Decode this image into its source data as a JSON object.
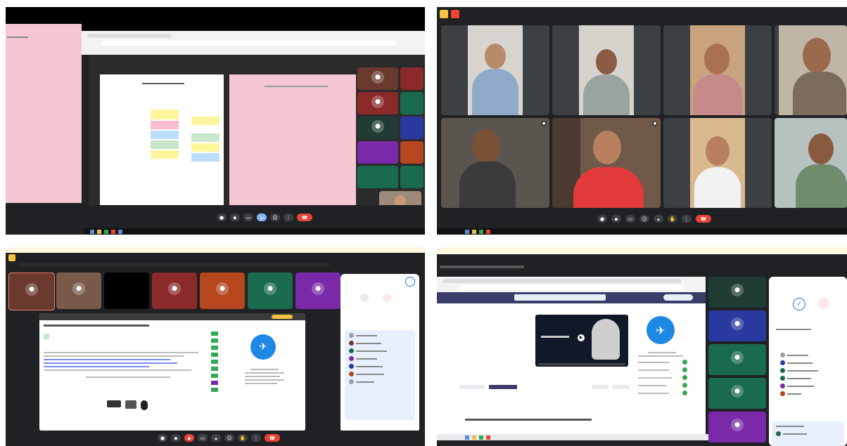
{
  "q1": {
    "tiles": [
      "",
      "",
      "",
      "",
      "",
      "",
      "",
      "",
      "",
      "",
      "",
      ""
    ],
    "clock": "",
    "meeting_title": ""
  },
  "q2": {
    "names": [
      "",
      "",
      "",
      "",
      "",
      "",
      "",
      ""
    ],
    "clock": "",
    "meeting_title": ""
  },
  "q3": {
    "banner_title": "",
    "tiles": [
      {
        "name": "",
        "color": "#6b3a2e"
      },
      {
        "name": "",
        "color": "#7a5a4a"
      },
      {
        "name": "",
        "color": "#000000"
      },
      {
        "name": "",
        "color": "#8b2a2a"
      },
      {
        "name": "",
        "color": "#b5461e"
      },
      {
        "name": "",
        "color": "#1a6b4e"
      },
      {
        "name": "",
        "color": "#7a2aa8"
      }
    ],
    "doc_title": "",
    "side_panel_title": "",
    "clock": "",
    "meeting_title": ""
  },
  "q4": {
    "banner_title": "",
    "tab_title": "",
    "video_caption": "",
    "question_text": "",
    "side_panel_title": "",
    "tiles": [
      {
        "name": "",
        "color": "#1f3b34"
      },
      {
        "name": "",
        "color": "#2b3aa0"
      },
      {
        "name": "",
        "color": "#1a6b4e"
      },
      {
        "name": "",
        "color": "#1a6b4e"
      },
      {
        "name": "",
        "color": "#7a2aa8"
      }
    ]
  },
  "icons": {
    "mic": "mic-icon",
    "camera": "camera-icon",
    "present": "present-icon",
    "hangup": "hangup-icon"
  },
  "colors": {
    "meet_dark": "#202124",
    "hangup_red": "#ea4335",
    "doc_pink": "#f4c7d3",
    "accent_blue": "#8ab4f8"
  }
}
